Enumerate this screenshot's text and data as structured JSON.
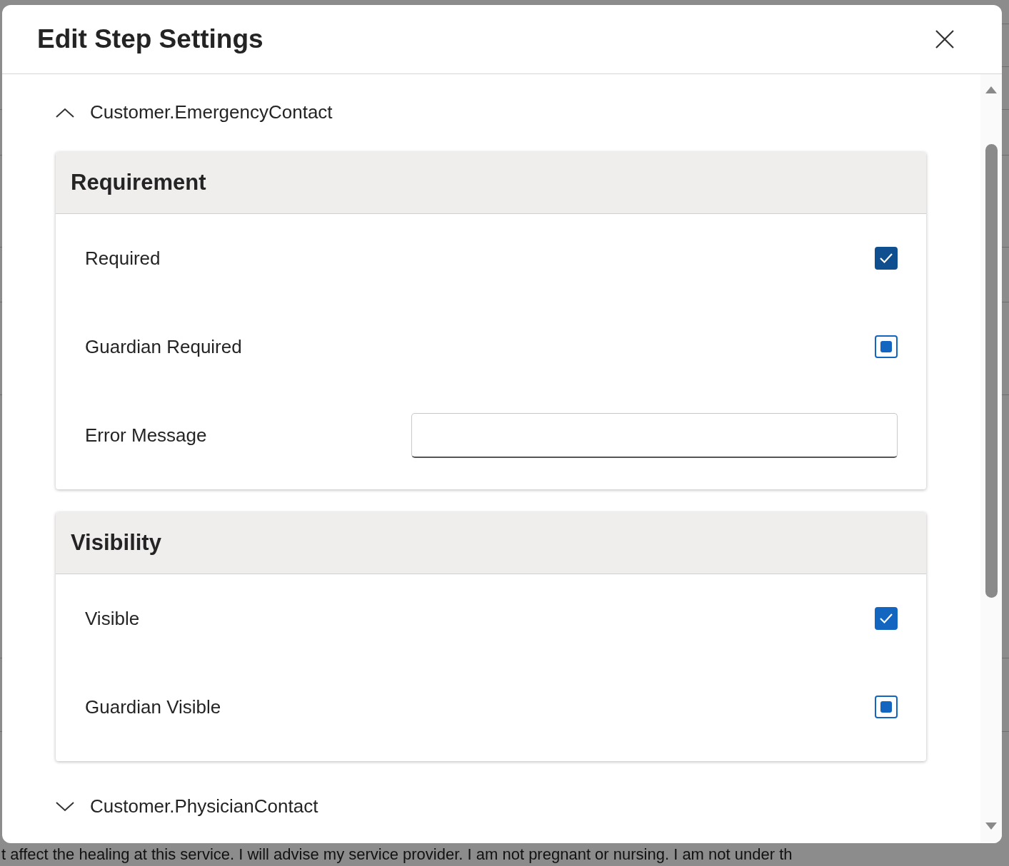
{
  "background": {
    "bottom_text": "t affect the healing at this service. I will advise my service provider. I am not pregnant or nursing. I am not under th"
  },
  "dialog": {
    "title": "Edit Step Settings"
  },
  "sections": [
    {
      "title": "Customer.EmergencyContact",
      "expanded": true,
      "groups": [
        {
          "title": "Requirement",
          "fields": [
            {
              "kind": "checkbox",
              "label": "Required",
              "checked": true,
              "indeterminate": false
            },
            {
              "kind": "checkbox",
              "label": "Guardian Required",
              "checked": false,
              "indeterminate": true
            },
            {
              "kind": "text",
              "label": "Error Message"
            }
          ]
        },
        {
          "title": "Visibility",
          "fields": [
            {
              "kind": "checkbox",
              "label": "Visible",
              "checked": true,
              "indeterminate": false
            },
            {
              "kind": "checkbox",
              "label": "Guardian Visible",
              "checked": false,
              "indeterminate": true
            }
          ]
        }
      ]
    },
    {
      "title": "Customer.PhysicianContact",
      "expanded": false
    }
  ]
}
